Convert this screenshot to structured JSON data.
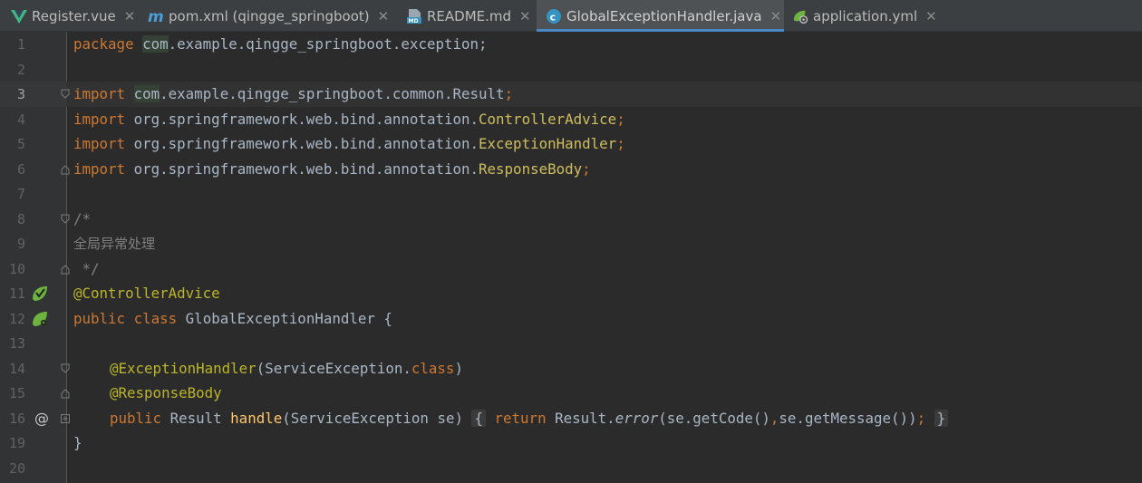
{
  "tabs": [
    {
      "label": "Register.vue",
      "icon": "vue-icon",
      "active": false
    },
    {
      "label": "pom.xml (qingge_springboot)",
      "icon": "maven-icon",
      "active": false
    },
    {
      "label": "README.md",
      "icon": "markdown-icon",
      "active": false
    },
    {
      "label": "GlobalExceptionHandler.java",
      "icon": "java-class-icon",
      "active": true
    },
    {
      "label": "application.yml",
      "icon": "spring-config-icon",
      "active": false
    }
  ],
  "close_glyph": "✕",
  "lines": {
    "l1": "1",
    "l2": "2",
    "l3": "3",
    "l4": "4",
    "l5": "5",
    "l6": "6",
    "l7": "7",
    "l8": "8",
    "l9": "9",
    "l10": "10",
    "l11": "11",
    "l12": "12",
    "l13": "13",
    "l14": "14",
    "l15": "15",
    "l16": "16",
    "l19": "19",
    "l20": "20"
  },
  "code": {
    "package_kw": "package",
    "package_first": "com",
    "package_rest": ".example.qingge_springboot.exception;",
    "import_kw": "import",
    "imp1_first": "com",
    "imp1_mid": ".example.qingge_springboot.common.",
    "imp1_cls": "Result",
    "imp_pkg": " org.springframework.web.bind.annotation.",
    "imp2_cls": "ControllerAdvice",
    "imp3_cls": "ExceptionHandler",
    "imp4_cls": "ResponseBody",
    "semi": ";",
    "cmt_open": "/*",
    "cmt_text": "全局异常处理",
    "cmt_close": " */",
    "ann_controller": "@ControllerAdvice",
    "public_kw": "public",
    "class_kw": "class",
    "class_name": " GlobalExceptionHandler {",
    "ann_exh": "@ExceptionHandler",
    "exh_args_a": "(ServiceException.",
    "exh_args_kw": "class",
    "exh_args_b": ")",
    "ann_rb": "@ResponseBody",
    "m_public": "public",
    "m_ret": " Result ",
    "m_name": "handle",
    "m_params": "(ServiceException se) ",
    "m_lbrace": "{",
    "m_return": "return",
    "m_result": " Result.",
    "m_error": "error",
    "m_args": "(se.getCode()",
    "m_comma": ",",
    "m_args2": "se.getMessage())",
    "m_semi": ";",
    "m_rbrace": "}",
    "close_brace": "}"
  },
  "gutter_icons": {
    "line11": "spring-bean-icon",
    "line12": "spring-bean-icon",
    "line16": "at-sign-icon",
    "at_glyph": "@"
  }
}
